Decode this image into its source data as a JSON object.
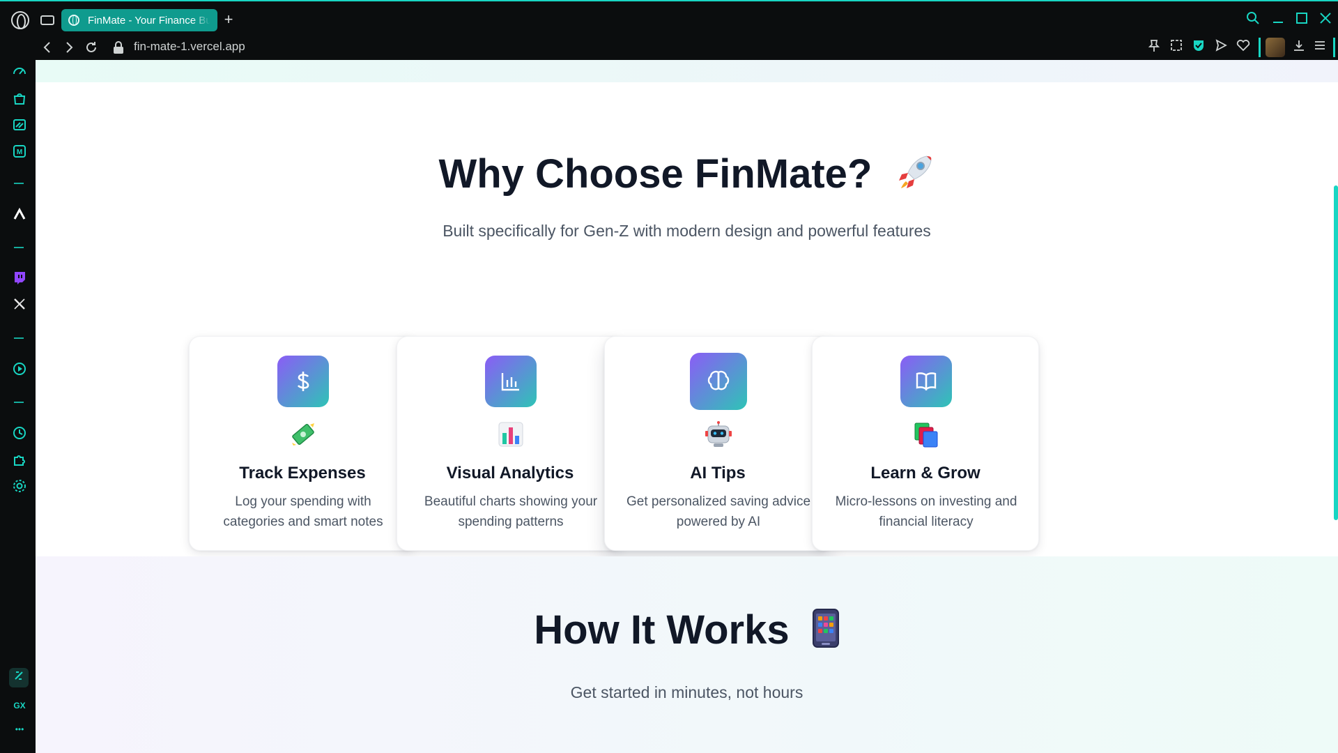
{
  "browser": {
    "tab_title": "FinMate - Your Finance Buddy",
    "url": "fin-mate-1.vercel.app",
    "accent_color": "#18d6c3"
  },
  "hero_why": {
    "title": "Why Choose FinMate?",
    "title_emoji": "rocket",
    "subtitle": "Built specifically for Gen-Z with modern design and powerful features"
  },
  "features": [
    {
      "icon": "dollar-icon",
      "emoji": "money-with-wings",
      "title": "Track Expenses",
      "desc": "Log your spending with categories and smart notes"
    },
    {
      "icon": "bar-chart-icon",
      "emoji": "bar-chart",
      "title": "Visual Analytics",
      "desc": "Beautiful charts showing your spending patterns"
    },
    {
      "icon": "brain-icon",
      "emoji": "robot",
      "title": "AI Tips",
      "desc": "Get personalized saving advice powered by AI"
    },
    {
      "icon": "book-open-icon",
      "emoji": "books",
      "title": "Learn & Grow",
      "desc": "Micro-lessons on investing and financial literacy"
    }
  ],
  "how": {
    "title": "How It Works",
    "title_emoji": "mobile-phone",
    "subtitle": "Get started in minutes, not hours"
  },
  "sidebar": {
    "gx_label": "GX",
    "more_label": "•••"
  }
}
